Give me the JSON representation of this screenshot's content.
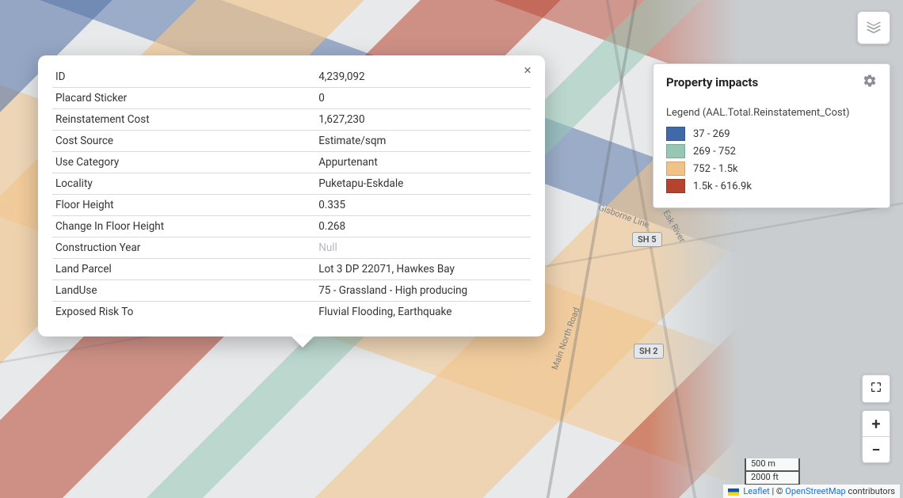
{
  "legend": {
    "title": "Property impacts",
    "subtitle": "Legend (AAL.Total.Reinstatement_Cost)",
    "items": [
      {
        "label": "37 - 269",
        "color": "#3f69a8"
      },
      {
        "label": "269 - 752",
        "color": "#95c7b4"
      },
      {
        "label": "752 - 1.5k",
        "color": "#f0c288"
      },
      {
        "label": "1.5k - 616.9k",
        "color": "#b5432d"
      }
    ]
  },
  "popup": {
    "rows": [
      {
        "key": "ID",
        "val": "4,239,092"
      },
      {
        "key": "Placard Sticker",
        "val": "0"
      },
      {
        "key": "Reinstatement Cost",
        "val": "1,627,230"
      },
      {
        "key": "Cost Source",
        "val": "Estimate/sqm"
      },
      {
        "key": "Use Category",
        "val": "Appurtenant"
      },
      {
        "key": "Locality",
        "val": "Puketapu-Eskdale"
      },
      {
        "key": "Floor Height",
        "val": "0.335"
      },
      {
        "key": "Change In Floor Height",
        "val": "0.268"
      },
      {
        "key": "Construction Year",
        "val": "Null",
        "null": true
      },
      {
        "key": "Land Parcel",
        "val": "Lot 3 DP 22071, Hawkes Bay"
      },
      {
        "key": "LandUse",
        "val": "75 - Grassland - High producing"
      },
      {
        "key": "Exposed Risk To",
        "val": "Fluvial Flooding, Earthquake"
      }
    ]
  },
  "map_labels": {
    "sh5": "SH 5",
    "sh2": "SH 2",
    "main_north_road": "Main North Road",
    "esk_river": "Esk River",
    "gisborne_line": "Gisborne Line"
  },
  "scale": {
    "metric": "500 m",
    "imperial": "2000 ft"
  },
  "attribution": {
    "leaflet": "Leaflet",
    "sep": " | © ",
    "osm": "OpenStreetMap",
    "tail": " contributors"
  }
}
